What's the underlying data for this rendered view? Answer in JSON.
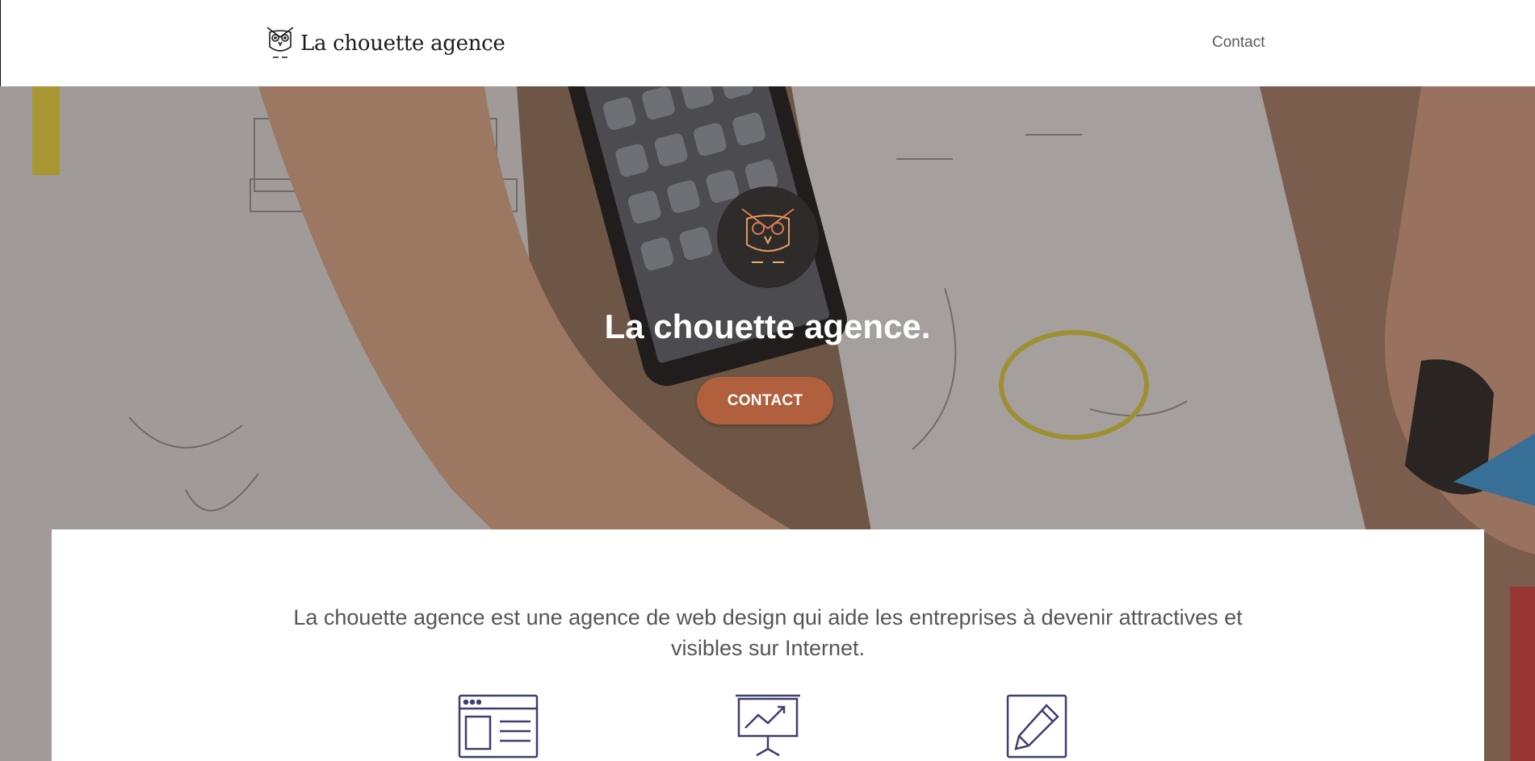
{
  "header": {
    "brand_name": "La chouette agence",
    "logo_icon": "owl-icon",
    "nav": {
      "contact_label": "Contact"
    }
  },
  "hero": {
    "logo_icon": "owl-icon",
    "title": "La chouette agence.",
    "cta_label": "CONTACT",
    "accent_color": "#b0603c"
  },
  "intro": {
    "line1": "La chouette agence est une agence de web design qui aide les entreprises à devenir attractives et",
    "line2": "visibles sur Internet."
  },
  "features": {
    "icons": [
      "browser-window-icon",
      "presentation-chart-icon",
      "pencil-edit-icon"
    ],
    "icon_color": "#3d3f6e"
  }
}
